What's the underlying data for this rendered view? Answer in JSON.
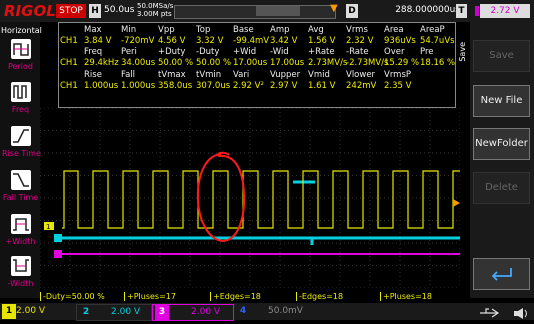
{
  "topbar": {
    "logo": "RIGOL",
    "run_state": "STOP",
    "h_label": "H",
    "timebase": "50.0us",
    "sample_rate_line1": "50.0MSa/s",
    "sample_rate_line2": "3.00M pts",
    "d_label": "D",
    "delay": "288.000000us",
    "t_label": "T",
    "trigger_level": "2.72 V",
    "colors": {
      "stop_bg": "#cc0000",
      "trigger": "#cc00cc"
    }
  },
  "sidebar": {
    "title": "Horizontal",
    "items": [
      {
        "label": "Period",
        "icon": "period-icon"
      },
      {
        "label": "Freq",
        "icon": "freq-icon"
      },
      {
        "label": "Rise Time",
        "icon": "rise-time-icon"
      },
      {
        "label": "Fall Time",
        "icon": "fall-time-icon"
      },
      {
        "label": "+Width",
        "icon": "positive-width-icon"
      },
      {
        "label": "-Width",
        "icon": "negative-width-icon"
      }
    ]
  },
  "measurements": {
    "rows": [
      {
        "channel": "",
        "cells": [
          "Max",
          "Min",
          "Vpp",
          "Top",
          "Base",
          "Amp",
          "Avg",
          "Vrms",
          "Area",
          "AreaP"
        ],
        "type": "header"
      },
      {
        "channel": "CH1",
        "cells": [
          "3.84 V",
          "-720mV",
          "4.56 V",
          "3.32 V",
          "-99.4mV",
          "3.42 V",
          "1.56 V",
          "2.32 V",
          "936uVs",
          "54.7uVs"
        ],
        "type": "value"
      },
      {
        "channel": "",
        "cells": [
          "Freq",
          "Peri",
          "+Duty",
          "-Duty",
          "+Wid",
          "-Wid",
          "+Rate",
          "-Rate",
          "Over",
          "Pre"
        ],
        "type": "header"
      },
      {
        "channel": "CH1",
        "cells": [
          "29.4kHz",
          "34.00us",
          "50.00 %",
          "50.00 %",
          "17.00us",
          "17.00us",
          "2.73MV/s",
          "-2.73MV/s",
          "15.29 %",
          "18.16 %"
        ],
        "type": "value"
      },
      {
        "channel": "",
        "cells": [
          "Rise",
          "Fall",
          "tVmax",
          "tVmin",
          "Vari",
          "Vupper",
          "Vmid",
          "Vlower",
          "VrmsP",
          ""
        ],
        "type": "header"
      },
      {
        "channel": "CH1",
        "cells": [
          "1.000us",
          "1.000us",
          "358.0us",
          "307.0us",
          "2.92 V²",
          "2.97 V",
          "1.61 V",
          "242mV",
          "2.35 V",
          ""
        ],
        "type": "value"
      }
    ]
  },
  "right_menu": {
    "tab": "Save",
    "buttons": [
      {
        "label": "Save",
        "enabled": false
      },
      {
        "label": "New File",
        "enabled": true
      },
      {
        "label": "NewFolder",
        "enabled": true
      },
      {
        "label": "Delete",
        "enabled": false
      },
      {
        "label": "",
        "enabled": true,
        "icon": "return-arrow-icon"
      }
    ]
  },
  "stats": [
    "-Duty=50.00 %",
    "+Pluses=17",
    "+Edges=18",
    "-Edges=18",
    "+Pluses=18"
  ],
  "channels": [
    {
      "num": "1",
      "value": "2.00 V",
      "color": "#e6e600"
    },
    {
      "num": "2",
      "value": "2.00 V",
      "color": "#00d0e0"
    },
    {
      "num": "3",
      "value": "2.00 V",
      "color": "#e000e0"
    },
    {
      "num": "4",
      "value": "50.0mV",
      "color": "#3060ff"
    }
  ]
}
